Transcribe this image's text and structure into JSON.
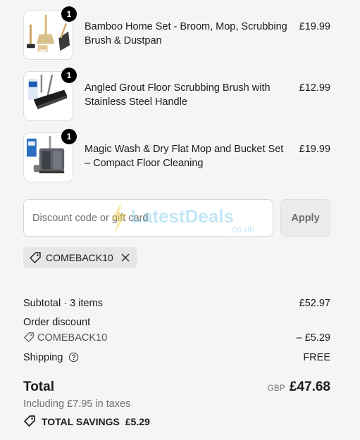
{
  "line_items": [
    {
      "name": "Bamboo Home Set - Broom, Mop, Scrubbing Brush & Dustpan",
      "price": "£19.99",
      "qty": "1"
    },
    {
      "name": "Angled Grout Floor Scrubbing Brush with Stainless Steel Handle",
      "price": "£12.99",
      "qty": "1"
    },
    {
      "name": "Magic Wash & Dry Flat Mop and Bucket Set – Compact Floor Cleaning",
      "price": "£19.99",
      "qty": "1"
    }
  ],
  "discount": {
    "placeholder": "Discount code or gift card",
    "apply_label": "Apply",
    "applied_code": "COMEBACK10"
  },
  "watermark": {
    "brand": "LatestDeals",
    "suffix": ".co.uk"
  },
  "summary": {
    "subtotal_label": "Subtotal · 3 items",
    "subtotal_value": "£52.97",
    "order_discount_label": "Order discount",
    "discount_code": "COMEBACK10",
    "discount_value": "– £5.29",
    "shipping_label": "Shipping",
    "shipping_value": "FREE",
    "total_label": "Total",
    "currency": "GBP",
    "total_value": "£47.68",
    "taxes_note": "Including £7.95 in taxes",
    "savings_label": "TOTAL SAVINGS",
    "savings_value": "£5.29"
  },
  "icons": {
    "tag": "tag-icon",
    "remove": "close-icon",
    "help": "question-circle-icon"
  },
  "colors": {
    "background": "#f5f5f5",
    "text": "#1a1a1a",
    "muted": "#707070",
    "watermark_blue": "#2aa7e0"
  }
}
